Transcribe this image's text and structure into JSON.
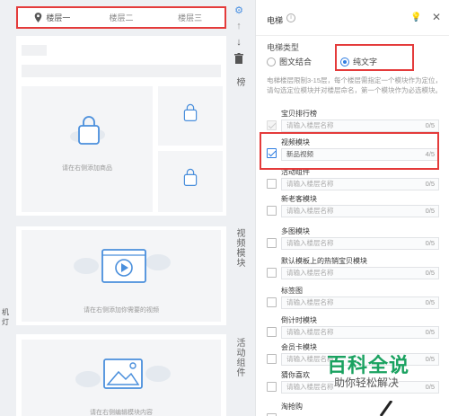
{
  "canvas": {
    "floors": [
      "楼层一",
      "楼层二",
      "楼层三"
    ],
    "module1_hint": "请在右侧添加商品",
    "module2_hint": "请在右侧添加你需要的视频",
    "module3_hint": "请在右侧编辑模块内容"
  },
  "edge_text": "机\n灯",
  "side": {
    "top_label": "榜",
    "video_label": "视频模块",
    "activity_label": "活动组件"
  },
  "panel": {
    "title": "电梯",
    "type_label": "电梯类型",
    "radio_mixed": "图文结合",
    "radio_text": "纯文字",
    "hint": "电梯楼层限制3-15层，每个楼层需指定一个模块作为定位，请勾选定位模块并对楼层命名，第一个模块作为必选模块。",
    "items": [
      {
        "label": "宝贝排行榜",
        "value": "",
        "placeholder": "请输入楼层名称",
        "count": "0/5",
        "state": "disabled"
      },
      {
        "label": "视频模块",
        "value": "新品视频",
        "placeholder": "",
        "count": "4/5",
        "state": "checked"
      },
      {
        "label": "活动组件",
        "value": "",
        "placeholder": "请输入楼层名称",
        "count": "0/5",
        "state": "off"
      },
      {
        "label": "新老客模块",
        "value": "",
        "placeholder": "请输入楼层名称",
        "count": "0/5",
        "state": "off"
      },
      {
        "label": "多图模块",
        "value": "",
        "placeholder": "请输入楼层名称",
        "count": "0/5",
        "state": "off"
      },
      {
        "label": "默认模板上的热销宝贝模块",
        "value": "",
        "placeholder": "请输入楼层名称",
        "count": "0/5",
        "state": "off"
      },
      {
        "label": "标签图",
        "value": "",
        "placeholder": "请输入楼层名称",
        "count": "0/5",
        "state": "off"
      },
      {
        "label": "倒计时模块",
        "value": "",
        "placeholder": "请输入楼层名称",
        "count": "0/5",
        "state": "off"
      },
      {
        "label": "会员卡模块",
        "value": "",
        "placeholder": "请输入楼层名称",
        "count": "0/5",
        "state": "off"
      },
      {
        "label": "猜你喜欢",
        "value": "",
        "placeholder": "请输入楼层名称",
        "count": "0/5",
        "state": "off"
      },
      {
        "label": "淘抢购",
        "value": "",
        "placeholder": "",
        "count": "",
        "state": "off"
      }
    ]
  },
  "watermark": {
    "big": "百科全说",
    "small": "助你轻松解决"
  },
  "colors": {
    "highlight": "#e43b3b",
    "accent": "#2f7de1",
    "brand": "#1aa260"
  }
}
